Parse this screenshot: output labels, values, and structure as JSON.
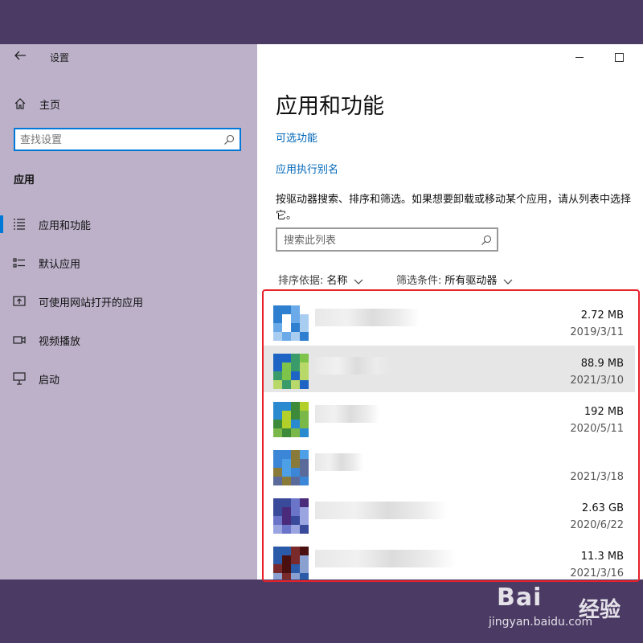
{
  "window": {
    "title": "设置"
  },
  "sidebar": {
    "home_label": "主页",
    "search_placeholder": "查找设置",
    "section_heading": "应用",
    "items": [
      {
        "label": "应用和功能",
        "icon": "apps-features-icon",
        "selected": true
      },
      {
        "label": "默认应用",
        "icon": "default-apps-icon",
        "selected": false
      },
      {
        "label": "可使用网站打开的应用",
        "icon": "apps-for-websites-icon",
        "selected": false
      },
      {
        "label": "视频播放",
        "icon": "video-playback-icon",
        "selected": false
      },
      {
        "label": "启动",
        "icon": "startup-icon",
        "selected": false
      }
    ]
  },
  "main": {
    "title": "应用和功能",
    "link_optional_features": "可选功能",
    "link_app_aliases": "应用执行别名",
    "description": "按驱动器搜索、排序和筛选。如果想要卸载或移动某个应用，请从列表中选择它。",
    "list_search_placeholder": "搜索此列表",
    "sort_label": "排序依据:",
    "sort_value": "名称",
    "filter_label": "筛选条件:",
    "filter_value": "所有驱动器"
  },
  "apps": [
    {
      "size": "2.72 MB",
      "date": "2019/3/11",
      "icon_colors": [
        "#2f7fd0",
        "#ffffff",
        "#6aaae8",
        "#a9cdf0"
      ]
    },
    {
      "size": "88.9 MB",
      "date": "2021/3/10",
      "icon_colors": [
        "#1e64c4",
        "#7fc44a",
        "#3a9b6a",
        "#b8d86a"
      ]
    },
    {
      "size": "192 MB",
      "date": "2020/5/11",
      "icon_colors": [
        "#2a8ad0",
        "#b2cf2a",
        "#3d8a3a",
        "#7ab84a"
      ]
    },
    {
      "size": "",
      "date": "2021/3/18",
      "icon_colors": [
        "#3b86d6",
        "#4ea0e6",
        "#8a7a3a",
        "#5a6a9a"
      ]
    },
    {
      "size": "2.63 GB",
      "date": "2020/6/22",
      "icon_colors": [
        "#3a4a9a",
        "#4a2a7a",
        "#6a74c8",
        "#9aa4e0"
      ]
    },
    {
      "size": "11.3 MB",
      "date": "2021/3/16",
      "icon_colors": [
        "#2a5aa8",
        "#4a1010",
        "#7a2a2a",
        "#8aa0d0"
      ]
    }
  ],
  "watermark": {
    "brand": "Bai",
    "brand_cn": "经验",
    "url": "jingyan.baidu.com"
  }
}
